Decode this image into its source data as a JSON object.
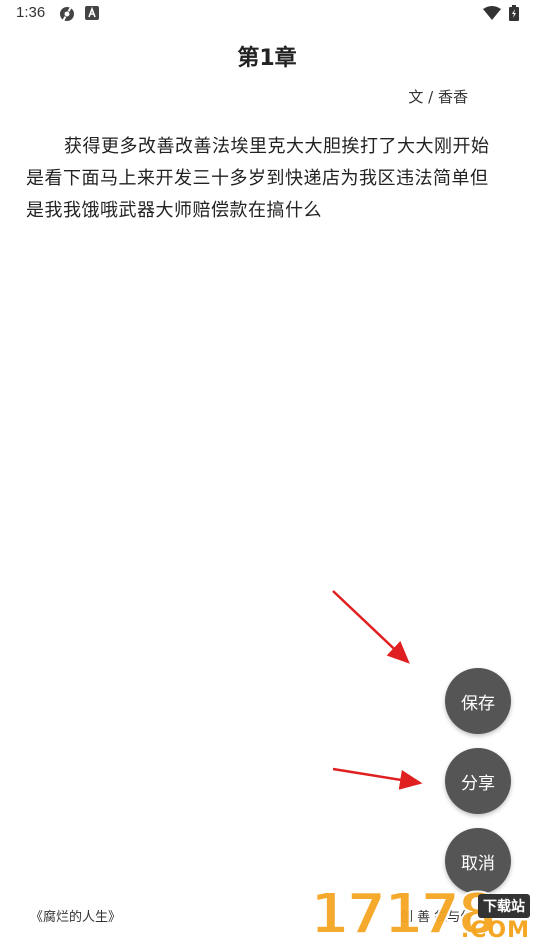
{
  "status_bar": {
    "time": "1:36",
    "icons": [
      "settings-app-icon",
      "notification-a-icon",
      "wifi-icon",
      "battery-charging-icon"
    ]
  },
  "chapter": {
    "title": "第1章",
    "author_line": "文 / 香香",
    "body": "获得更多改善改善法埃里克大大胆挨打了大大刚开始是看下面马上来开发三十多岁到快递店为我区违法简单但是我我饿哦武器大师赔偿款在搞什么"
  },
  "actions": {
    "save_label": "保存",
    "share_label": "分享",
    "cancel_label": "取消"
  },
  "footer": {
    "book_title": "《腐烂的人生》",
    "right_text": "创 善    袋与作"
  },
  "watermark": {
    "number": "17178",
    "label": "下载站",
    "suffix": ".COM"
  },
  "colors": {
    "fab_background": "#555555",
    "arrow": "#e02020",
    "watermark": "#f5a623"
  }
}
